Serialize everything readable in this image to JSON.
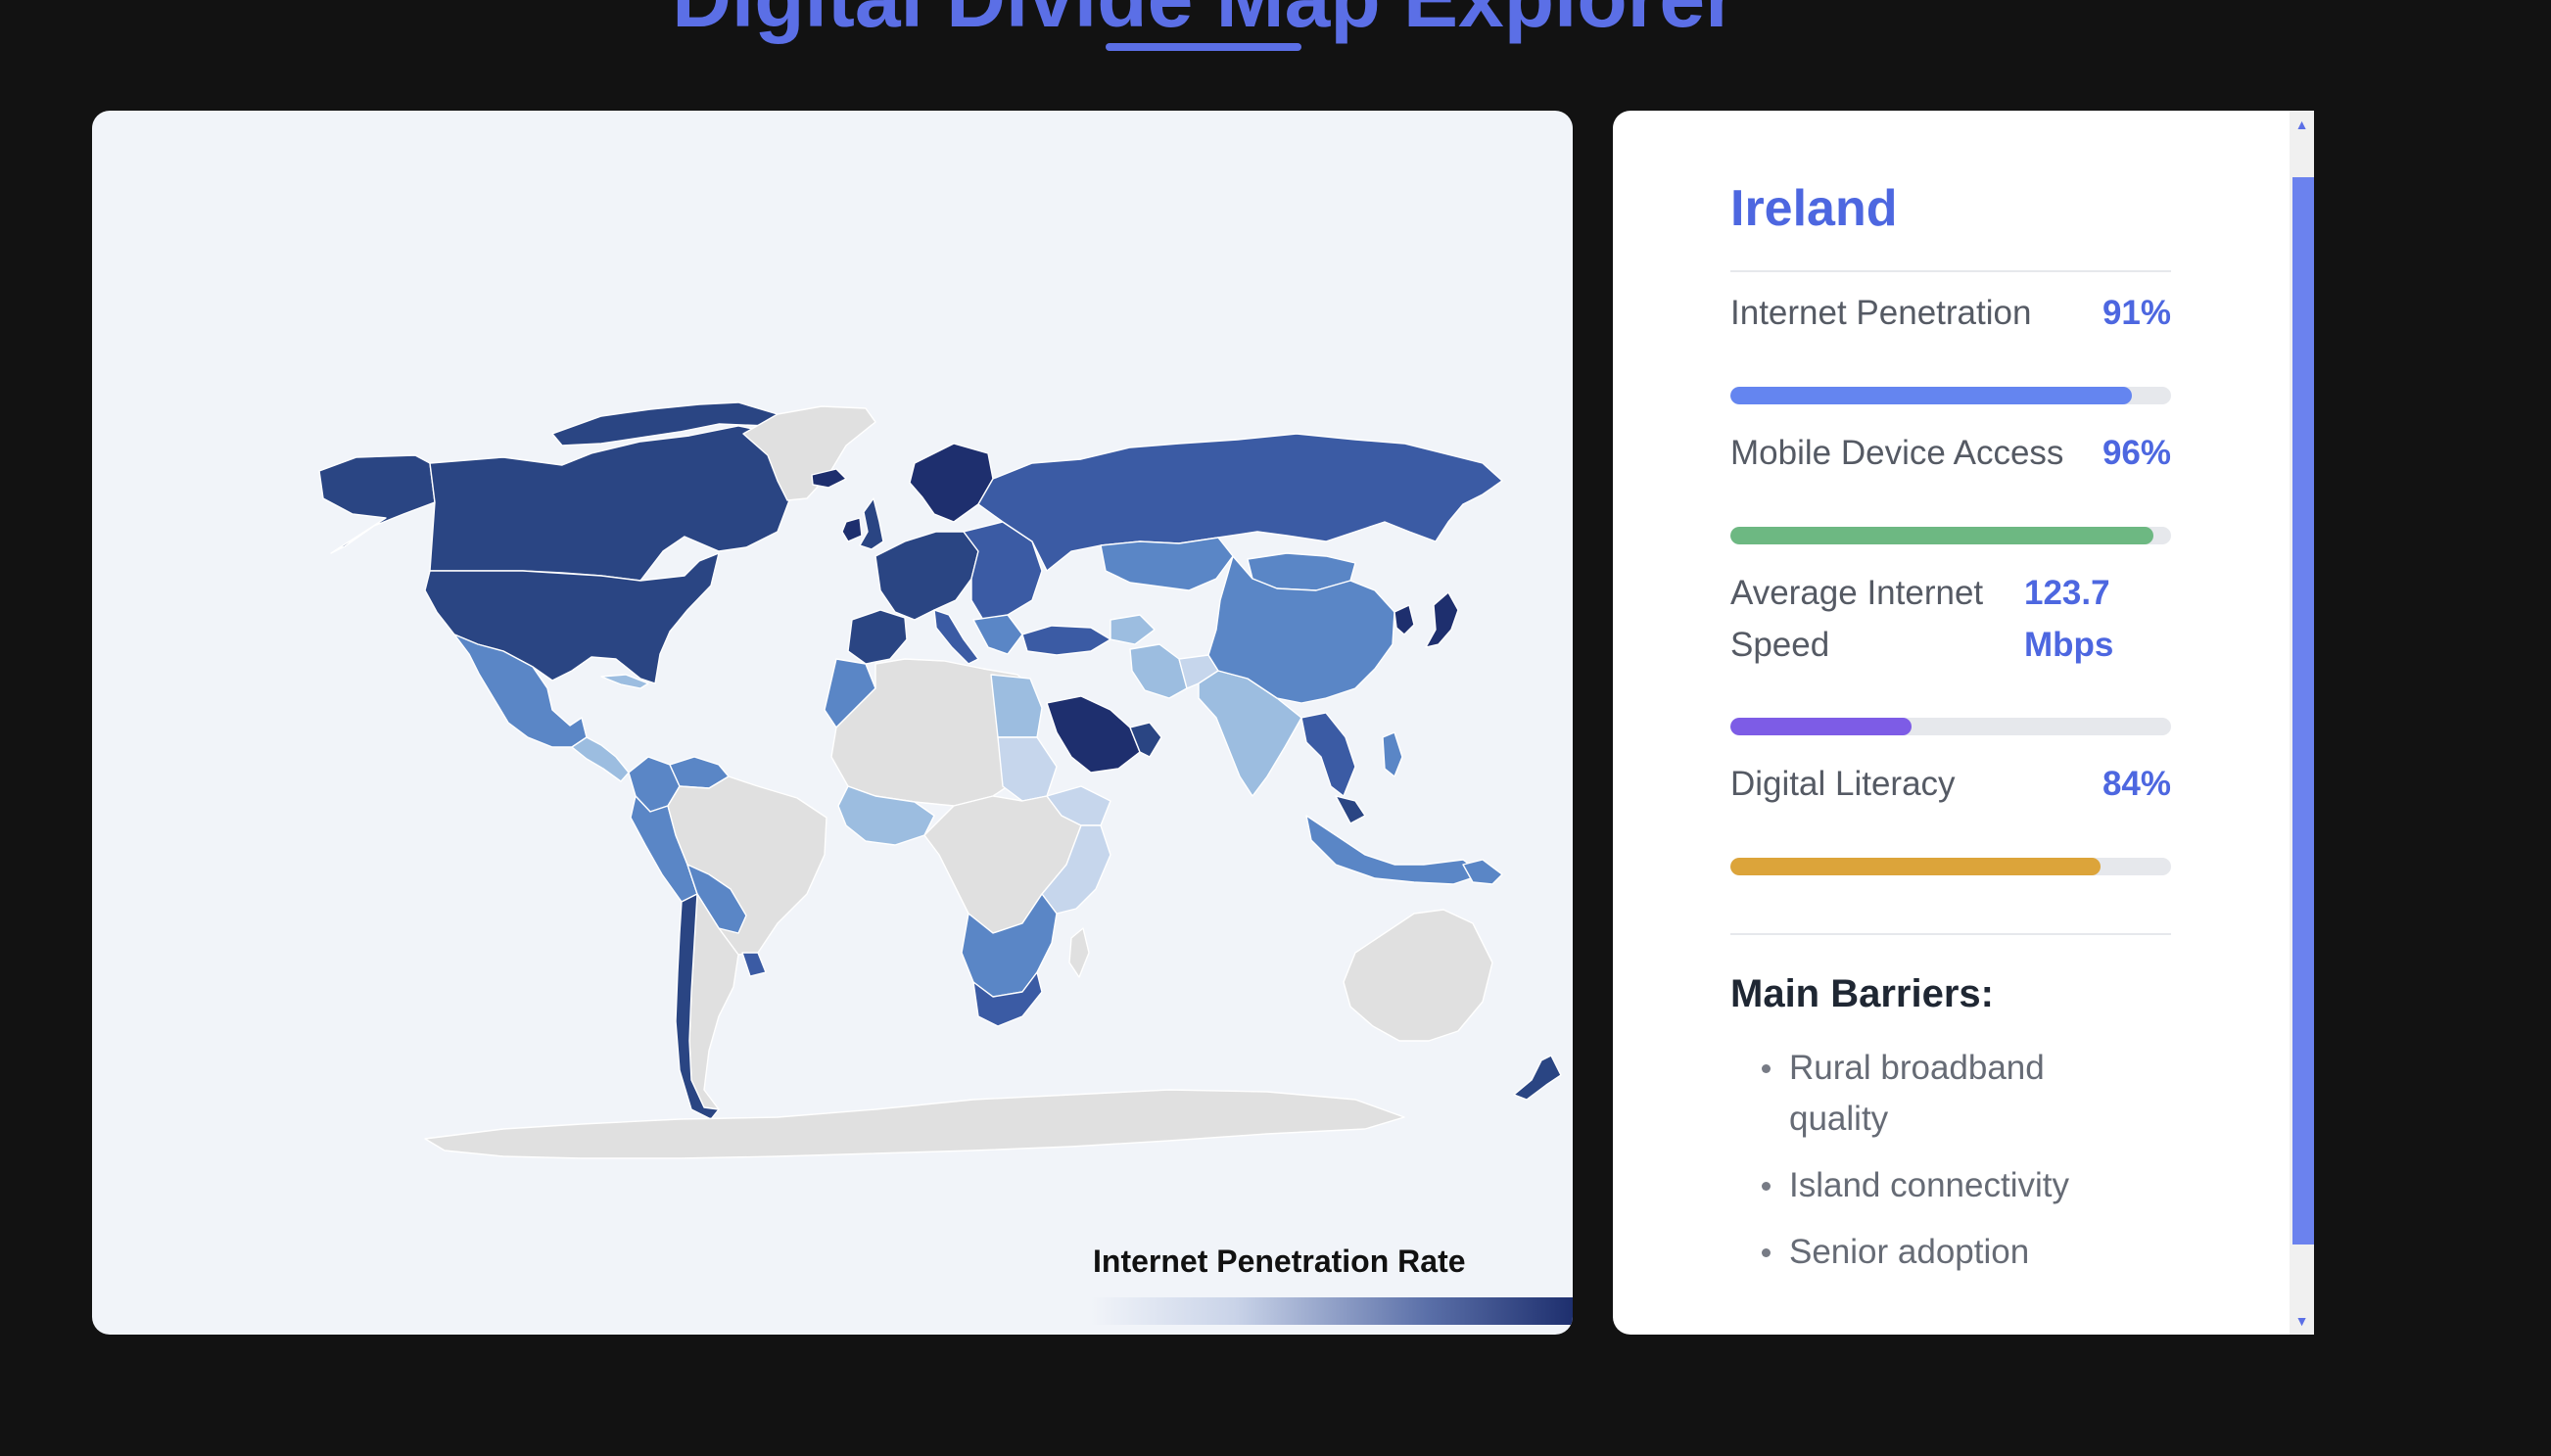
{
  "header": {
    "title": "Digital Divide Map Explorer"
  },
  "colors": {
    "accent": "#5b6fe6",
    "page_background": "#121212",
    "map_background": "#f1f4f9",
    "no_data": "#e0e0e0"
  },
  "map": {
    "legend_title": "Internet Penetration Rate",
    "color_scale": [
      "#c6d6ec",
      "#9cbde0",
      "#5a86c6",
      "#3b5ba4",
      "#2a4583",
      "#1e2f6e"
    ]
  },
  "panel": {
    "country": "Ireland",
    "metrics": [
      {
        "label": "Internet Penetration",
        "value": "91%",
        "fraction": 0.91,
        "color": "#6485f0"
      },
      {
        "label": "Mobile Device Access",
        "value": "96%",
        "fraction": 0.96,
        "color": "#6db882"
      },
      {
        "label_line1": "Average Internet",
        "label_line2": "Speed",
        "value_line1": "123.7",
        "value_line2": "Mbps",
        "fraction": 0.41,
        "color": "#7d5ce6"
      },
      {
        "label": "Digital Literacy",
        "value": "84%",
        "fraction": 0.84,
        "color": "#dca43a"
      }
    ],
    "barriers_title": "Main Barriers:",
    "barriers": [
      {
        "line1": "Rural broadband",
        "line2": "quality"
      },
      {
        "line1": "Island connectivity",
        "line2": ""
      },
      {
        "line1": "Senior adoption",
        "line2": ""
      }
    ]
  }
}
